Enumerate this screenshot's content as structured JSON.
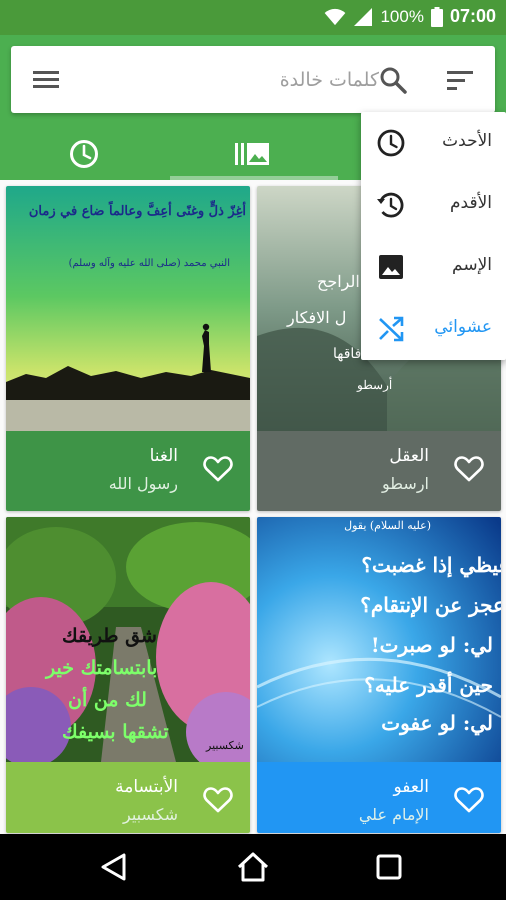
{
  "status": {
    "battery": "100%",
    "time": "07:00"
  },
  "search": {
    "placeholder": "كلمات خالدة"
  },
  "tabs": [
    {
      "name": "recent",
      "icon": "clock-icon"
    },
    {
      "name": "gallery",
      "icon": "gallery-icon"
    },
    {
      "name": "third",
      "icon": ""
    }
  ],
  "menu": {
    "items": [
      {
        "label": "الأحدث",
        "icon": "clock-icon"
      },
      {
        "label": "الأقدم",
        "icon": "history-icon"
      },
      {
        "label": "الإسم",
        "icon": "image-icon"
      },
      {
        "label": "عشوائي",
        "icon": "shuffle-icon",
        "color": "#2196f3"
      }
    ]
  },
  "cards": [
    {
      "title": "الغنا",
      "author": "رسول الله",
      "footer_color": "#3e9447",
      "img_lines": [
        "أغِزّ ذلٍّ وغنًى أعِفَّ وعالماً ضاع في زمان",
        "النبي محمد (صلى الله عليه وآله وسلم)"
      ]
    },
    {
      "title": "العقل",
      "author": "ارسطو",
      "footer_color": "#616b64",
      "img_lines": [
        "الراجح",
        "ل الافكار",
        "فاقها",
        "أرسطو"
      ]
    },
    {
      "title": "الأبتسامة",
      "author": "شكسبير",
      "footer_color": "#8bc34a",
      "img_lines": [
        "شق طريقك",
        "بابتسامتك خير",
        "لك من أن",
        "تشقها بسيفك",
        "شكسبير"
      ]
    },
    {
      "title": "العفو",
      "author": "الإمام علي",
      "footer_color": "#2196f3",
      "img_lines": [
        "(عليه السلام) يقول",
        "غيظي إذا غضبت؟",
        "عجز عن الإنتقام؟",
        "لي: لو صبرت!",
        "حين أقدر عليه؟",
        "لي: لو عفوت"
      ]
    }
  ],
  "colors": {
    "primary": "#4caf50",
    "status": "#4a9a3a",
    "accent": "#2196f3"
  }
}
